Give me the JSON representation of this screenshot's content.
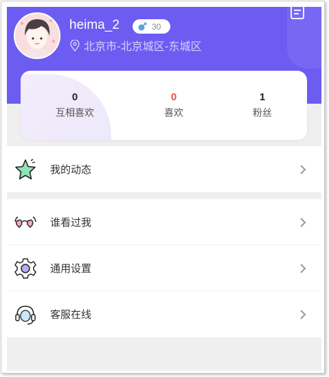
{
  "profile": {
    "username": "heima_2",
    "age": "30",
    "gender_icon": "male-symbol-icon",
    "location": "北京市-北京城区-东城区"
  },
  "stats": [
    {
      "value": "0",
      "label": "互相喜欢"
    },
    {
      "value": "0",
      "label": "喜欢"
    },
    {
      "value": "1",
      "label": "粉丝"
    }
  ],
  "menu": {
    "group1": [
      {
        "label": "我的动态",
        "icon": "star-icon"
      }
    ],
    "group2": [
      {
        "label": "谁看过我",
        "icon": "glasses-icon"
      },
      {
        "label": "通用设置",
        "icon": "gear-icon"
      },
      {
        "label": "客服在线",
        "icon": "headset-icon"
      }
    ]
  },
  "colors": {
    "header": "#6c5cf2",
    "accent_red": "#ee4b43"
  }
}
